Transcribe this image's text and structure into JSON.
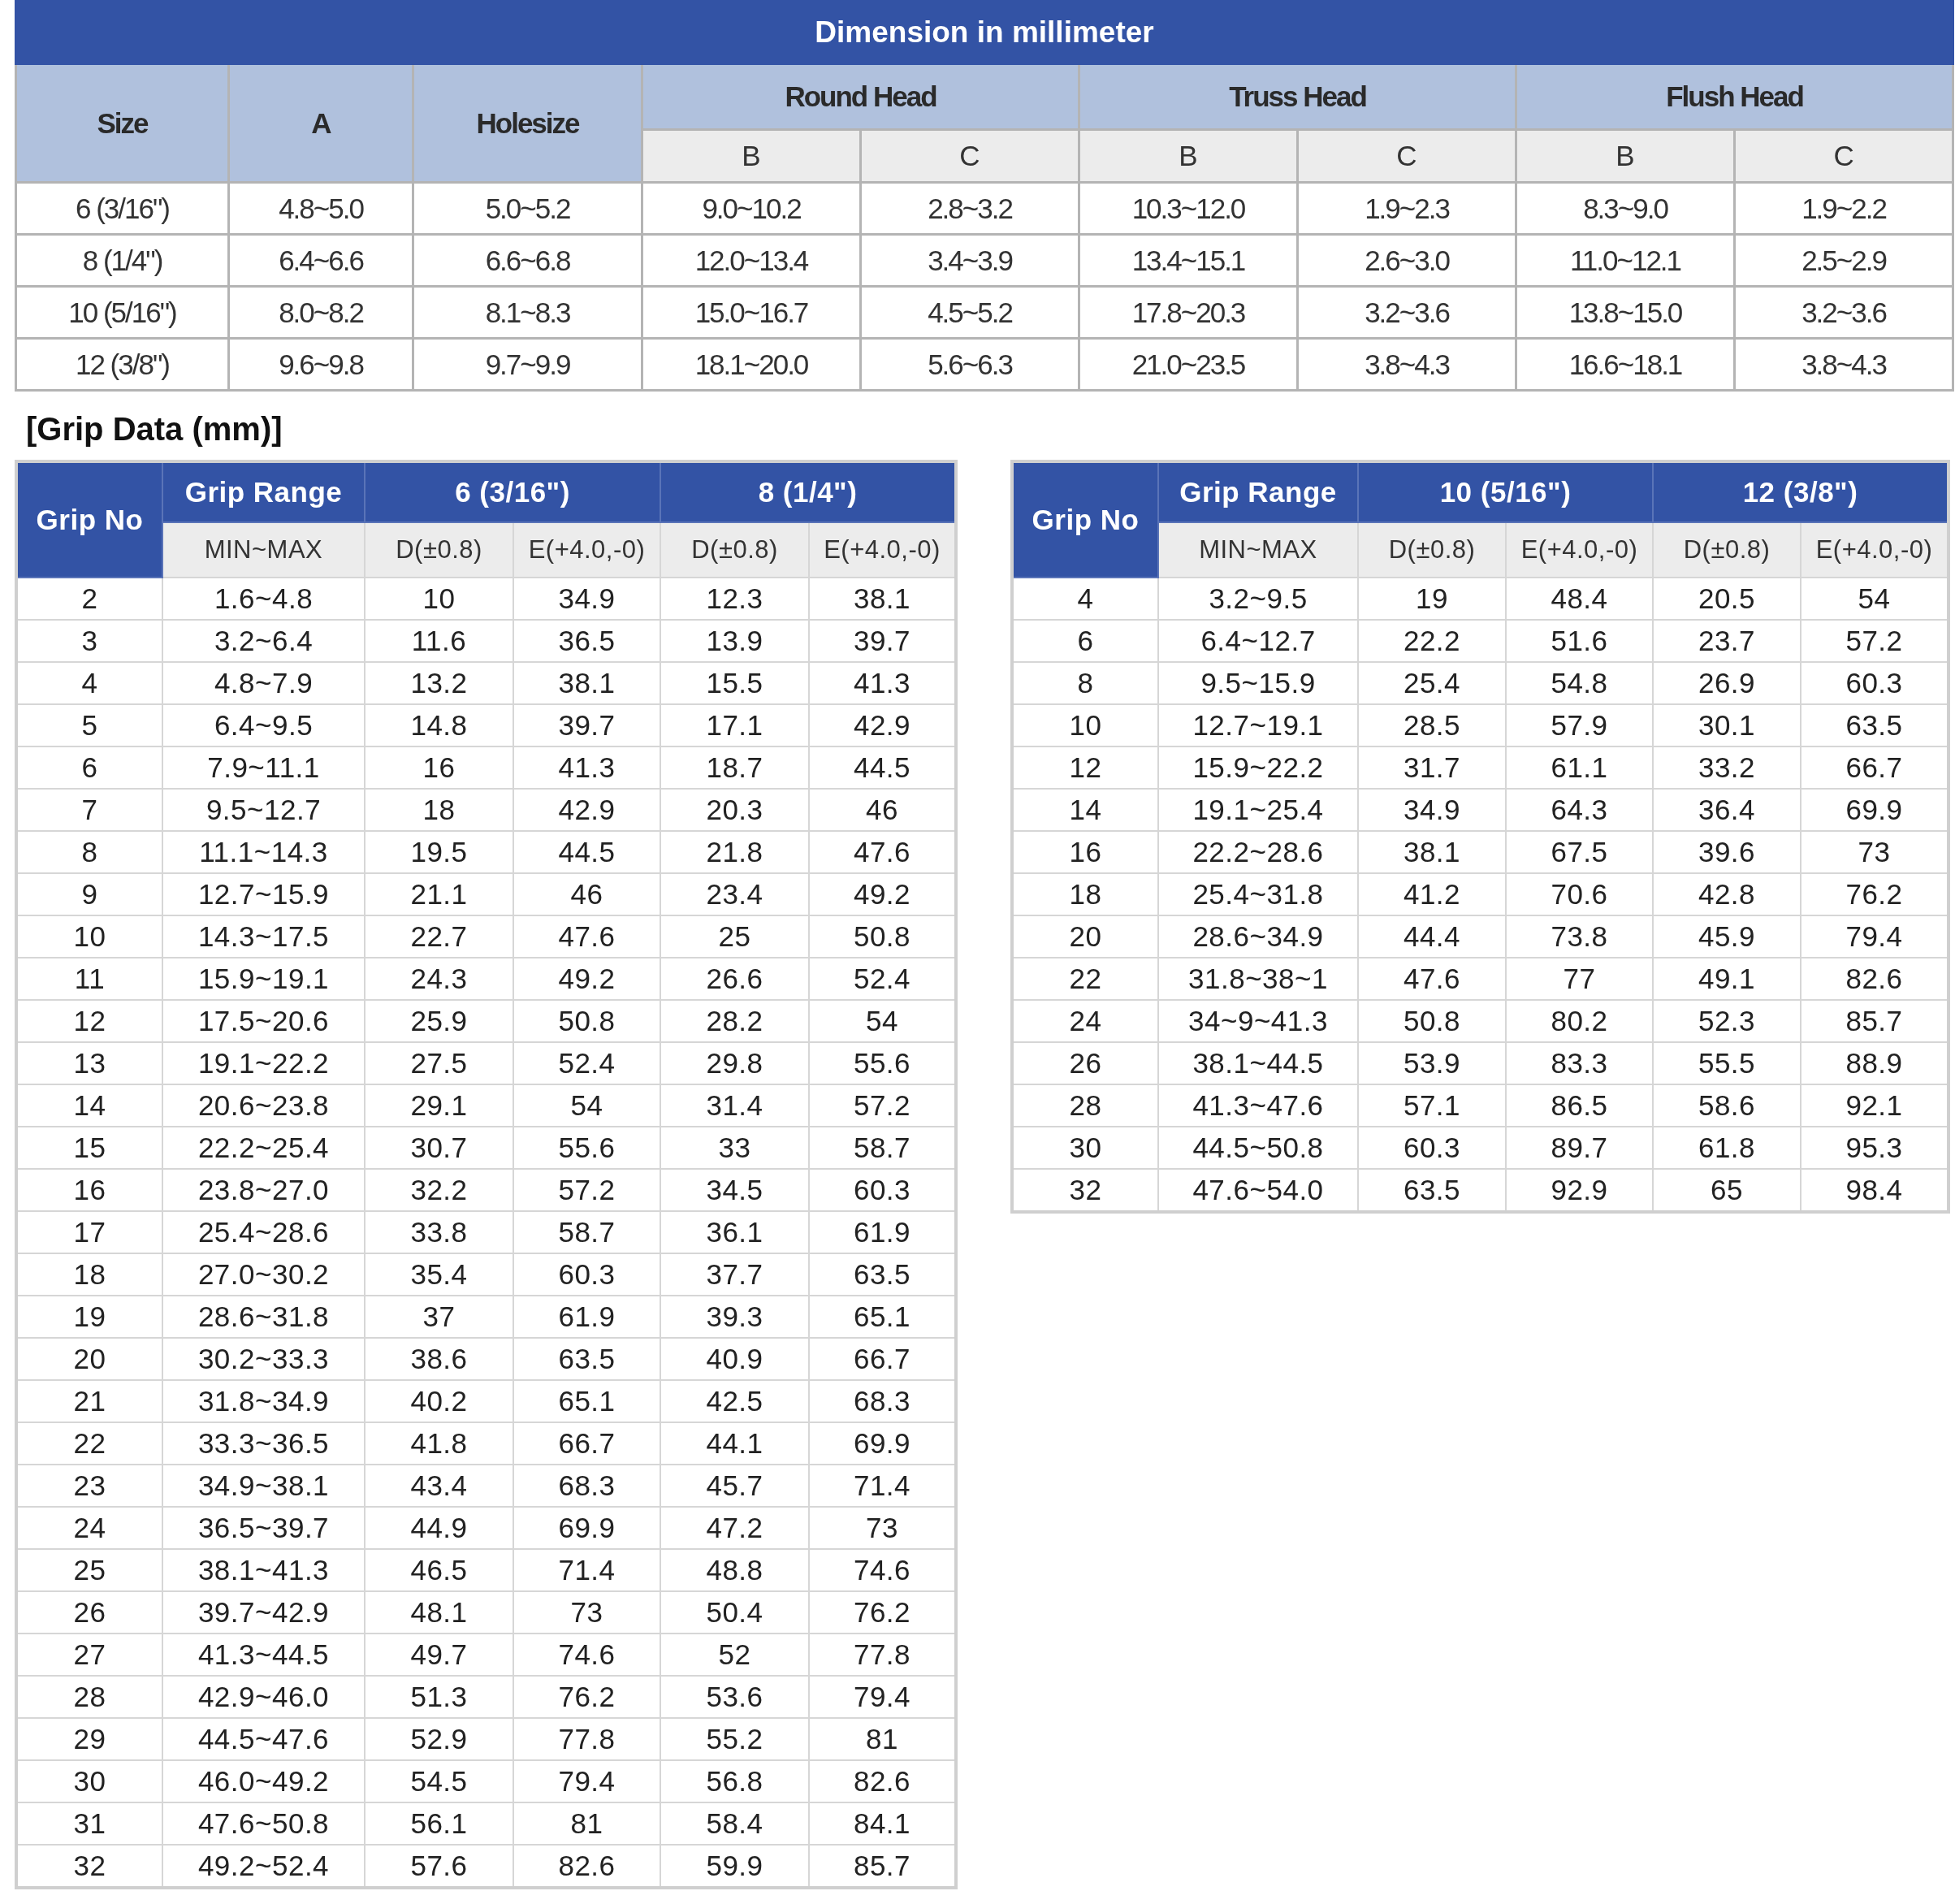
{
  "dimension_table": {
    "title": "Dimension in millimeter",
    "columns": [
      "Size",
      "A",
      "Holesize"
    ],
    "groups": [
      {
        "name": "Round Head",
        "subcolumns": [
          "B",
          "C"
        ]
      },
      {
        "name": "Truss Head",
        "subcolumns": [
          "B",
          "C"
        ]
      },
      {
        "name": "Flush Head",
        "subcolumns": [
          "B",
          "C"
        ]
      }
    ],
    "rows": [
      [
        "6 (3/16\")",
        "4.8~5.0",
        "5.0~5.2",
        "9.0~10.2",
        "2.8~3.2",
        "10.3~12.0",
        "1.9~2.3",
        "8.3~9.0",
        "1.9~2.2"
      ],
      [
        "8 (1/4\")",
        "6.4~6.6",
        "6.6~6.8",
        "12.0~13.4",
        "3.4~3.9",
        "13.4~15.1",
        "2.6~3.0",
        "11.0~12.1",
        "2.5~2.9"
      ],
      [
        "10 (5/16\")",
        "8.0~8.2",
        "8.1~8.3",
        "15.0~16.7",
        "4.5~5.2",
        "17.8~20.3",
        "3.2~3.6",
        "13.8~15.0",
        "3.2~3.6"
      ],
      [
        "12 (3/8\")",
        "9.6~9.8",
        "9.7~9.9",
        "18.1~20.0",
        "5.6~6.3",
        "21.0~23.5",
        "3.8~4.3",
        "16.6~18.1",
        "3.8~4.3"
      ]
    ]
  },
  "grip_data": {
    "title": "[Grip Data (mm)]",
    "tables": [
      {
        "grip_no": "Grip No",
        "grip_range": "Grip Range",
        "range_sub": "MIN~MAX",
        "groups": [
          {
            "name": "6 (3/16\")",
            "subcolumns": [
              "D(±0.8)",
              "E(+4.0,-0)"
            ]
          },
          {
            "name": "8 (1/4\")",
            "subcolumns": [
              "D(±0.8)",
              "E(+4.0,-0)"
            ]
          }
        ],
        "rows": [
          [
            "2",
            "1.6~4.8",
            "10",
            "34.9",
            "12.3",
            "38.1"
          ],
          [
            "3",
            "3.2~6.4",
            "11.6",
            "36.5",
            "13.9",
            "39.7"
          ],
          [
            "4",
            "4.8~7.9",
            "13.2",
            "38.1",
            "15.5",
            "41.3"
          ],
          [
            "5",
            "6.4~9.5",
            "14.8",
            "39.7",
            "17.1",
            "42.9"
          ],
          [
            "6",
            "7.9~11.1",
            "16",
            "41.3",
            "18.7",
            "44.5"
          ],
          [
            "7",
            "9.5~12.7",
            "18",
            "42.9",
            "20.3",
            "46"
          ],
          [
            "8",
            "11.1~14.3",
            "19.5",
            "44.5",
            "21.8",
            "47.6"
          ],
          [
            "9",
            "12.7~15.9",
            "21.1",
            "46",
            "23.4",
            "49.2"
          ],
          [
            "10",
            "14.3~17.5",
            "22.7",
            "47.6",
            "25",
            "50.8"
          ],
          [
            "11",
            "15.9~19.1",
            "24.3",
            "49.2",
            "26.6",
            "52.4"
          ],
          [
            "12",
            "17.5~20.6",
            "25.9",
            "50.8",
            "28.2",
            "54"
          ],
          [
            "13",
            "19.1~22.2",
            "27.5",
            "52.4",
            "29.8",
            "55.6"
          ],
          [
            "14",
            "20.6~23.8",
            "29.1",
            "54",
            "31.4",
            "57.2"
          ],
          [
            "15",
            "22.2~25.4",
            "30.7",
            "55.6",
            "33",
            "58.7"
          ],
          [
            "16",
            "23.8~27.0",
            "32.2",
            "57.2",
            "34.5",
            "60.3"
          ],
          [
            "17",
            "25.4~28.6",
            "33.8",
            "58.7",
            "36.1",
            "61.9"
          ],
          [
            "18",
            "27.0~30.2",
            "35.4",
            "60.3",
            "37.7",
            "63.5"
          ],
          [
            "19",
            "28.6~31.8",
            "37",
            "61.9",
            "39.3",
            "65.1"
          ],
          [
            "20",
            "30.2~33.3",
            "38.6",
            "63.5",
            "40.9",
            "66.7"
          ],
          [
            "21",
            "31.8~34.9",
            "40.2",
            "65.1",
            "42.5",
            "68.3"
          ],
          [
            "22",
            "33.3~36.5",
            "41.8",
            "66.7",
            "44.1",
            "69.9"
          ],
          [
            "23",
            "34.9~38.1",
            "43.4",
            "68.3",
            "45.7",
            "71.4"
          ],
          [
            "24",
            "36.5~39.7",
            "44.9",
            "69.9",
            "47.2",
            "73"
          ],
          [
            "25",
            "38.1~41.3",
            "46.5",
            "71.4",
            "48.8",
            "74.6"
          ],
          [
            "26",
            "39.7~42.9",
            "48.1",
            "73",
            "50.4",
            "76.2"
          ],
          [
            "27",
            "41.3~44.5",
            "49.7",
            "74.6",
            "52",
            "77.8"
          ],
          [
            "28",
            "42.9~46.0",
            "51.3",
            "76.2",
            "53.6",
            "79.4"
          ],
          [
            "29",
            "44.5~47.6",
            "52.9",
            "77.8",
            "55.2",
            "81"
          ],
          [
            "30",
            "46.0~49.2",
            "54.5",
            "79.4",
            "56.8",
            "82.6"
          ],
          [
            "31",
            "47.6~50.8",
            "56.1",
            "81",
            "58.4",
            "84.1"
          ],
          [
            "32",
            "49.2~52.4",
            "57.6",
            "82.6",
            "59.9",
            "85.7"
          ]
        ]
      },
      {
        "grip_no": "Grip No",
        "grip_range": "Grip Range",
        "range_sub": "MIN~MAX",
        "groups": [
          {
            "name": "10 (5/16\")",
            "subcolumns": [
              "D(±0.8)",
              "E(+4.0,-0)"
            ]
          },
          {
            "name": "12 (3/8\")",
            "subcolumns": [
              "D(±0.8)",
              "E(+4.0,-0)"
            ]
          }
        ],
        "rows": [
          [
            "4",
            "3.2~9.5",
            "19",
            "48.4",
            "20.5",
            "54"
          ],
          [
            "6",
            "6.4~12.7",
            "22.2",
            "51.6",
            "23.7",
            "57.2"
          ],
          [
            "8",
            "9.5~15.9",
            "25.4",
            "54.8",
            "26.9",
            "60.3"
          ],
          [
            "10",
            "12.7~19.1",
            "28.5",
            "57.9",
            "30.1",
            "63.5"
          ],
          [
            "12",
            "15.9~22.2",
            "31.7",
            "61.1",
            "33.2",
            "66.7"
          ],
          [
            "14",
            "19.1~25.4",
            "34.9",
            "64.3",
            "36.4",
            "69.9"
          ],
          [
            "16",
            "22.2~28.6",
            "38.1",
            "67.5",
            "39.6",
            "73"
          ],
          [
            "18",
            "25.4~31.8",
            "41.2",
            "70.6",
            "42.8",
            "76.2"
          ],
          [
            "20",
            "28.6~34.9",
            "44.4",
            "73.8",
            "45.9",
            "79.4"
          ],
          [
            "22",
            "31.8~38~1",
            "47.6",
            "77",
            "49.1",
            "82.6"
          ],
          [
            "24",
            "34~9~41.3",
            "50.8",
            "80.2",
            "52.3",
            "85.7"
          ],
          [
            "26",
            "38.1~44.5",
            "53.9",
            "83.3",
            "55.5",
            "88.9"
          ],
          [
            "28",
            "41.3~47.6",
            "57.1",
            "86.5",
            "58.6",
            "92.1"
          ],
          [
            "30",
            "44.5~50.8",
            "60.3",
            "89.7",
            "61.8",
            "95.3"
          ],
          [
            "32",
            "47.6~54.0",
            "63.5",
            "92.9",
            "65",
            "98.4"
          ]
        ]
      }
    ]
  }
}
